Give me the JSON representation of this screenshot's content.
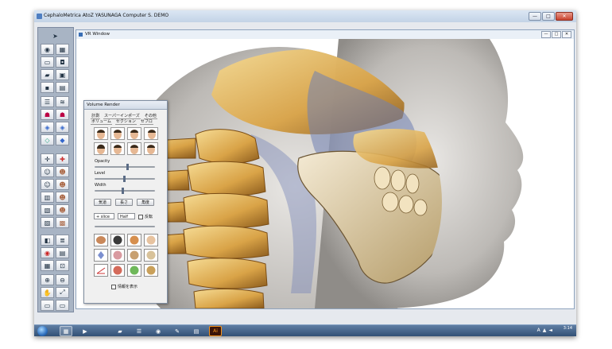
{
  "app": {
    "title": "CephaloMetrica AtoZ  YASUNAGA Computer S. DEMO"
  },
  "window_buttons": {
    "minimize": "—",
    "maximize": "□",
    "close": "✕"
  },
  "toolbar": {
    "icons": [
      "arrow-cursor",
      "globe",
      "grid",
      "monitor",
      "camera",
      "folder",
      "image",
      "save",
      "print",
      "layers",
      "layers-alt",
      "skull-view",
      "skull-view-2",
      "volume",
      "volume-2",
      "face-profile",
      "teeth",
      "split",
      "zoom-in",
      "zoom-out",
      "hand",
      "expand",
      "gallery"
    ]
  },
  "vr_window": {
    "title": "VR Window"
  },
  "volume_panel": {
    "title": "Volume Render",
    "tabs_row1": [
      "計測",
      "スーパーインポーズ",
      "その他"
    ],
    "tabs_row2": [
      "ボリューム",
      "セクション",
      "セフロ"
    ],
    "opacity_label": "Opacity",
    "level_label": "Level",
    "width_label": "Width",
    "opacity_value": 0.52,
    "level_value": 0.48,
    "width_value": 0.45,
    "btn_airway": "気道",
    "btn_length": "長さ",
    "btn_angle": "角度",
    "select_slice": "+ slice",
    "select_half": "Half",
    "check_invert": "反転",
    "check_show_info": "情報を表示"
  },
  "colors": {
    "bone": "#e8c06a",
    "bone_dark": "#8a5a1c",
    "soft_tissue": "#b9b6b4",
    "airway": "#6f7fb2",
    "toolbar_bg": "#a8b4c4",
    "taskbar": "#3b5a80"
  },
  "taskbar": {
    "apps": [
      "explorer",
      "media",
      "folder",
      "network",
      "chrome",
      "paint",
      "notepad",
      "illustrator"
    ],
    "illustrator_label": "Ai",
    "tray_lang": "A",
    "clock": "3:14"
  }
}
